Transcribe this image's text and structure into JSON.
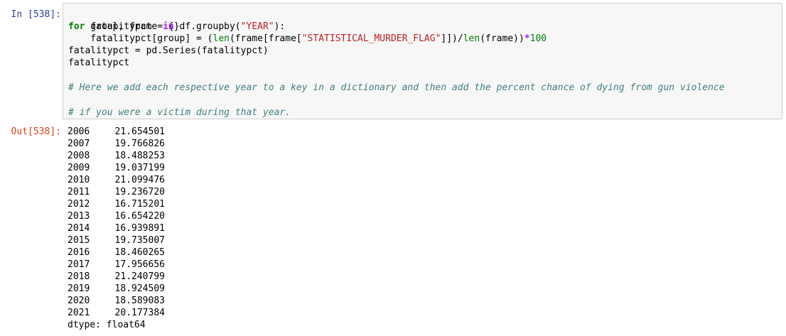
{
  "cell": {
    "in_prompt": "In [538]:",
    "out_prompt": "Out[538]:",
    "code": {
      "l1_a": "fatalitypct = {}",
      "l2_for": "for",
      "l2_b": " group, frame ",
      "l2_in": "in",
      "l2_c": " df.groupby(",
      "l2_str": "\"YEAR\"",
      "l2_d": "):",
      "l3_a": "    fatalitypct[group] = (",
      "l3_len1": "len",
      "l3_b": "(frame[frame[",
      "l3_str": "\"STATISTICAL_MURDER_FLAG\"",
      "l3_c": "]])/",
      "l3_len2": "len",
      "l3_d": "(frame))",
      "l3_op": "*",
      "l3_num": "100",
      "l4": "fatalitypct = pd.Series(fatalitypct)",
      "l5": "fatalitypct",
      "comment1": "# Here we add each respective year to a key in a dictionary and then add the percent chance of dying from gun violence",
      "comment2": "# if you were a victim during that year."
    },
    "output": {
      "rows": [
        {
          "year": "2006",
          "value": "21.654501"
        },
        {
          "year": "2007",
          "value": "19.766826"
        },
        {
          "year": "2008",
          "value": "18.488253"
        },
        {
          "year": "2009",
          "value": "19.037199"
        },
        {
          "year": "2010",
          "value": "21.099476"
        },
        {
          "year": "2011",
          "value": "19.236720"
        },
        {
          "year": "2012",
          "value": "16.715201"
        },
        {
          "year": "2013",
          "value": "16.654220"
        },
        {
          "year": "2014",
          "value": "16.939891"
        },
        {
          "year": "2015",
          "value": "19.735007"
        },
        {
          "year": "2016",
          "value": "18.460265"
        },
        {
          "year": "2017",
          "value": "17.956656"
        },
        {
          "year": "2018",
          "value": "21.240799"
        },
        {
          "year": "2019",
          "value": "18.924509"
        },
        {
          "year": "2020",
          "value": "18.589083"
        },
        {
          "year": "2021",
          "value": "20.177384"
        }
      ],
      "dtype": "dtype: float64"
    }
  }
}
